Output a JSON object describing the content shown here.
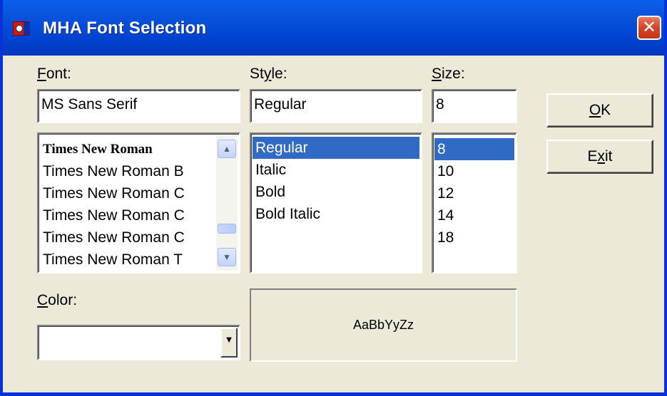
{
  "window": {
    "title": "MHA Font Selection",
    "close_glyph": "✕",
    "icon": "app-icon"
  },
  "font": {
    "label_accel": "F",
    "label_rest": "ont:",
    "value": "MS Sans Serif",
    "items": [
      "Times New Roman",
      "Times New Roman B",
      "Times New Roman C",
      "Times New Roman C",
      "Times New Roman C",
      "Times New Roman T"
    ],
    "scroll_up_glyph": "▲",
    "scroll_down_glyph": "▼"
  },
  "style": {
    "label_prefix": "St",
    "label_accel": "y",
    "label_rest": "le:",
    "value": "Regular",
    "items": [
      "Regular",
      "Italic",
      "Bold",
      "Bold Italic"
    ],
    "selected": "Regular"
  },
  "size": {
    "label_accel": "S",
    "label_rest": "ize:",
    "value": "8",
    "items": [
      "8",
      "10",
      "12",
      "14",
      "18"
    ],
    "selected": "8"
  },
  "buttons": {
    "ok_accel": "O",
    "ok_rest": "K",
    "exit_prefix": "E",
    "exit_accel": "x",
    "exit_rest": "it"
  },
  "color": {
    "label_accel": "C",
    "label_rest": "olor:",
    "value": "",
    "arrow_glyph": "▼"
  },
  "preview": {
    "sample_text": "AaBbYyZz"
  },
  "colors": {
    "titlebar": "#0a58e0",
    "dialog_bg": "#ece9d8",
    "selection": "#316ac5",
    "close_button": "#d5452a"
  }
}
